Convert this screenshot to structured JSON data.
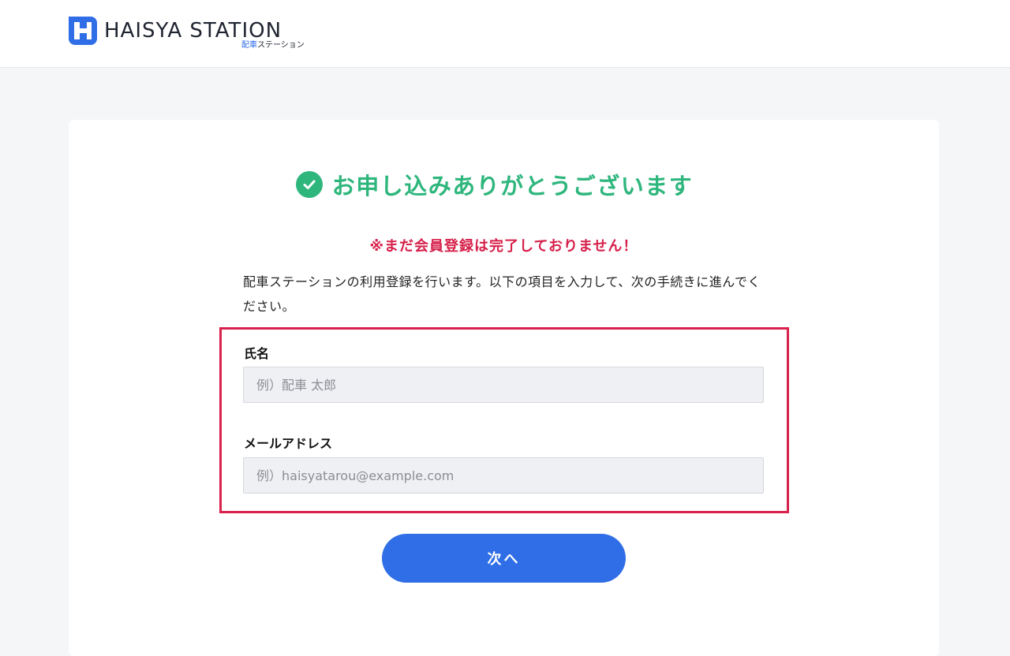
{
  "header": {
    "logo_text": "HAISYA STATION",
    "logo_sub_highlight": "配車",
    "logo_sub_rest": "ステーション"
  },
  "main": {
    "title": "お申し込みありがとうございます",
    "warning": "※まだ会員登録は完了しておりません！",
    "intro": "配車ステーションの利用登録を行います。以下の項目を入力して、次の手続きに進んでください。",
    "fields": {
      "name": {
        "label": "氏名",
        "value": "",
        "placeholder": "例）配車 太郎"
      },
      "email": {
        "label": "メールアドレス",
        "value": "",
        "placeholder": "例）haisyatarou@example.com"
      }
    },
    "next_label": "次へ"
  },
  "colors": {
    "accent": "#2f6ee6",
    "success": "#2eb67d",
    "warning": "#d6204a",
    "highlight_border": "#d8214c"
  },
  "icons": {
    "logo": "logo-h-mark-icon",
    "title": "check-circle-icon"
  }
}
